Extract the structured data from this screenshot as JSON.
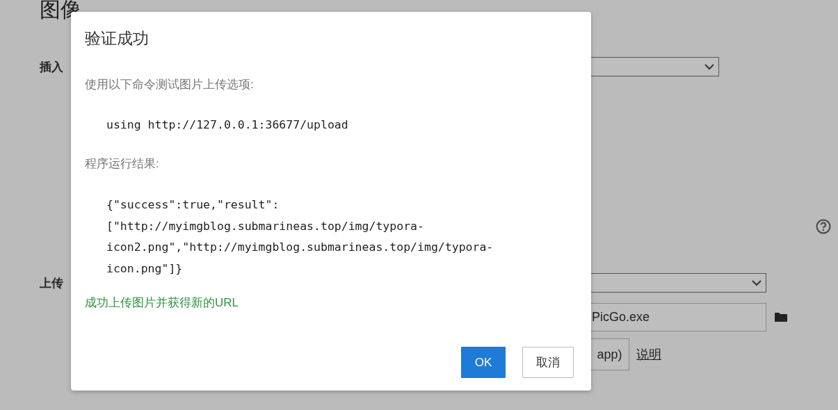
{
  "page": {
    "heading": "图像",
    "insert_label": "插入",
    "upload_label": "上传",
    "path_field": {
      "value": "PicGo.exe"
    },
    "test_button": "app)",
    "help_link": "说明"
  },
  "dialog": {
    "title": "验证成功",
    "command_intro": "使用以下命令测试图片上传选项:",
    "command": "using http://127.0.0.1:36677/upload",
    "result_intro": "程序运行结果:",
    "result_lines": [
      "{\"success\":true,\"result\":",
      "[\"http://myimgblog.submarineas.top/img/typora-",
      "icon2.png\",\"http://myimgblog.submarineas.top/img/typora-",
      "icon.png\"]}"
    ],
    "status": "成功上传图片并获得新的URL",
    "buttons": [
      {
        "label": "OK",
        "kind": "primary"
      },
      {
        "label": "取消",
        "kind": "secondary"
      }
    ]
  }
}
